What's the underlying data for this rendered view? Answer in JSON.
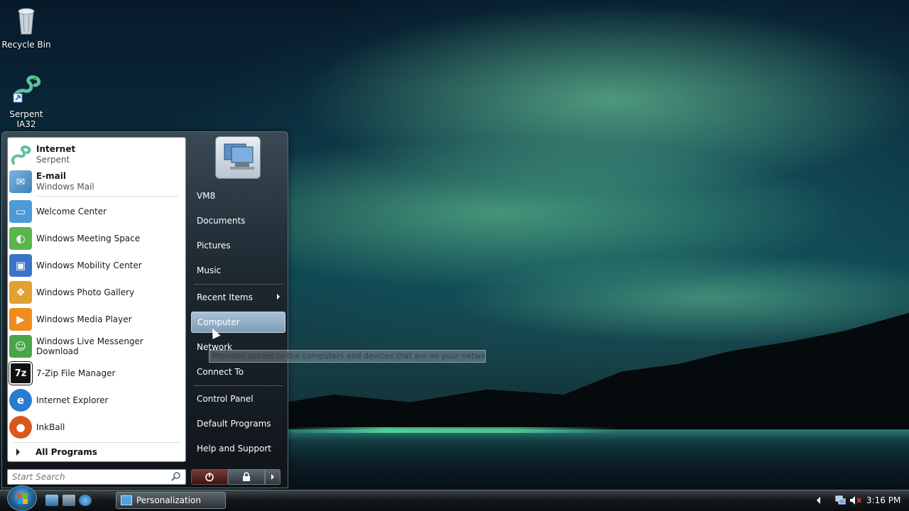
{
  "desktop": {
    "icons": [
      {
        "label": "Recycle Bin",
        "icon": "recycle-bin-icon"
      },
      {
        "label": "Serpent IA32",
        "icon": "serpent-icon"
      }
    ]
  },
  "start_menu": {
    "pinned": [
      {
        "title": "Internet",
        "subtitle": "Serpent",
        "icon": "serpent-icon"
      },
      {
        "title": "E-mail",
        "subtitle": "Windows Mail",
        "icon": "mail-icon"
      }
    ],
    "recent": [
      {
        "label": "Welcome Center",
        "icon": "welcome-center-icon",
        "color": "#4c9ad8"
      },
      {
        "label": "Windows Meeting Space",
        "icon": "meeting-space-icon",
        "color": "#5ab54b"
      },
      {
        "label": "Windows Mobility Center",
        "icon": "mobility-center-icon",
        "color": "#3a73c9"
      },
      {
        "label": "Windows Photo Gallery",
        "icon": "photo-gallery-icon",
        "color": "#e2a032"
      },
      {
        "label": "Windows Media Player",
        "icon": "media-player-icon",
        "color": "#f08c1e"
      },
      {
        "label": "Windows Live Messenger Download",
        "icon": "messenger-icon",
        "color": "#4aa54a"
      },
      {
        "label": "7-Zip File Manager",
        "icon": "7zip-icon",
        "color": "#111111"
      },
      {
        "label": "Internet Explorer",
        "icon": "ie-icon",
        "color": "#2a7bd1"
      },
      {
        "label": "InkBall",
        "icon": "inkball-icon",
        "color": "#d9581c"
      }
    ],
    "all_programs": "All Programs",
    "search_placeholder": "Start Search",
    "right": [
      {
        "label": "VM8"
      },
      {
        "label": "Documents"
      },
      {
        "label": "Pictures"
      },
      {
        "label": "Music"
      },
      {
        "label": "Recent Items"
      },
      {
        "label": "Computer"
      },
      {
        "label": "Network"
      },
      {
        "label": "Connect To"
      },
      {
        "label": "Control Panel"
      },
      {
        "label": "Default Programs"
      },
      {
        "label": "Help and Support"
      }
    ],
    "tooltip": "Provides access to the computers and devices that are on your network."
  },
  "taskbar": {
    "task_label": "Personalization",
    "clock": "3:16 PM"
  }
}
